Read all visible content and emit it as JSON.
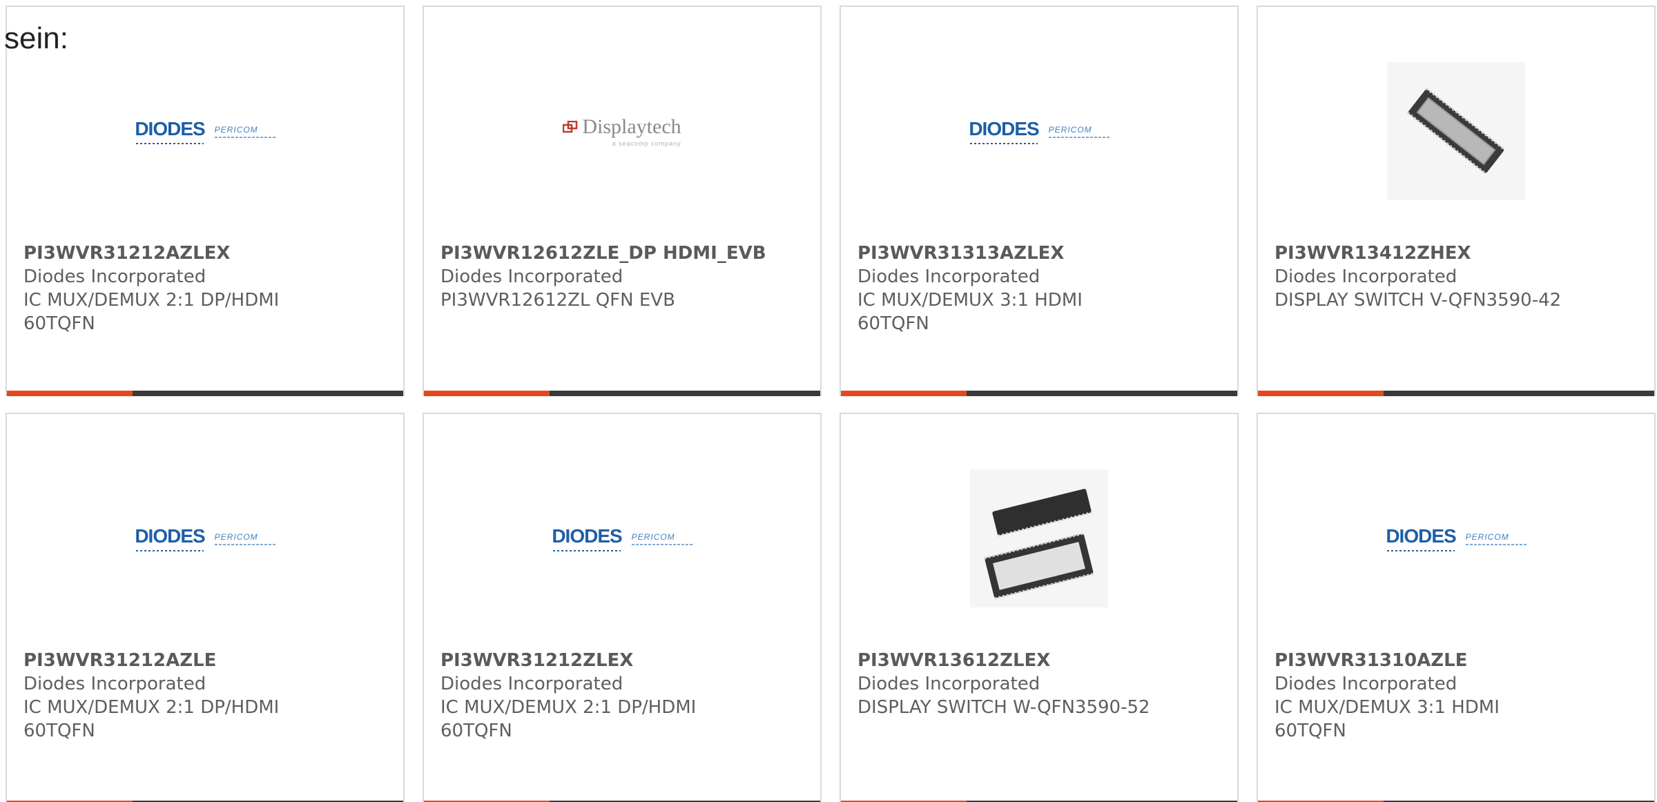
{
  "intro_text": "sein:",
  "colors": {
    "accent": "#e8471b",
    "bar": "#3a3a3a",
    "border": "#d9d9d9",
    "diodes_blue": "#1d5fa6"
  },
  "logos": {
    "diodes": {
      "wordmark": "DIODES",
      "subbrand": "PERICOM"
    },
    "displaytech": {
      "wordmark": "Displaytech",
      "tagline": "a seacomp company"
    }
  },
  "products": [
    {
      "part": "PI3WVR31212AZLEX",
      "manufacturer": "Diodes Incorporated",
      "description": "IC MUX/DEMUX 2:1 DP/HDMI\n60TQFN",
      "image": "diodes-pericom-logo"
    },
    {
      "part": "PI3WVR12612ZLE_DP HDMI_EVB",
      "manufacturer": "Diodes Incorporated",
      "description": "PI3WVR12612ZL QFN EVB",
      "image": "displaytech-logo"
    },
    {
      "part": "PI3WVR31313AZLEX",
      "manufacturer": "Diodes Incorporated",
      "description": "IC MUX/DEMUX 3:1 HDMI\n60TQFN",
      "image": "diodes-pericom-logo"
    },
    {
      "part": "PI3WVR13412ZHEX",
      "manufacturer": "Diodes Incorporated",
      "description": "DISPLAY SWITCH V-QFN3590-42",
      "image": "qfn-chip-photo"
    },
    {
      "part": "PI3WVR31212AZLE",
      "manufacturer": "Diodes Incorporated",
      "description": "IC MUX/DEMUX 2:1 DP/HDMI\n60TQFN",
      "image": "diodes-pericom-logo"
    },
    {
      "part": "PI3WVR31212ZLEX",
      "manufacturer": "Diodes Incorporated",
      "description": "IC MUX/DEMUX 2:1 DP/HDMI\n60TQFN",
      "image": "diodes-pericom-logo"
    },
    {
      "part": "PI3WVR13612ZLEX",
      "manufacturer": "Diodes Incorporated",
      "description": "DISPLAY SWITCH W-QFN3590-52",
      "image": "qfn-chip-pair-photo"
    },
    {
      "part": "PI3WVR31310AZLE",
      "manufacturer": "Diodes Incorporated",
      "description": "IC MUX/DEMUX 3:1 HDMI\n60TQFN",
      "image": "diodes-pericom-logo"
    }
  ]
}
